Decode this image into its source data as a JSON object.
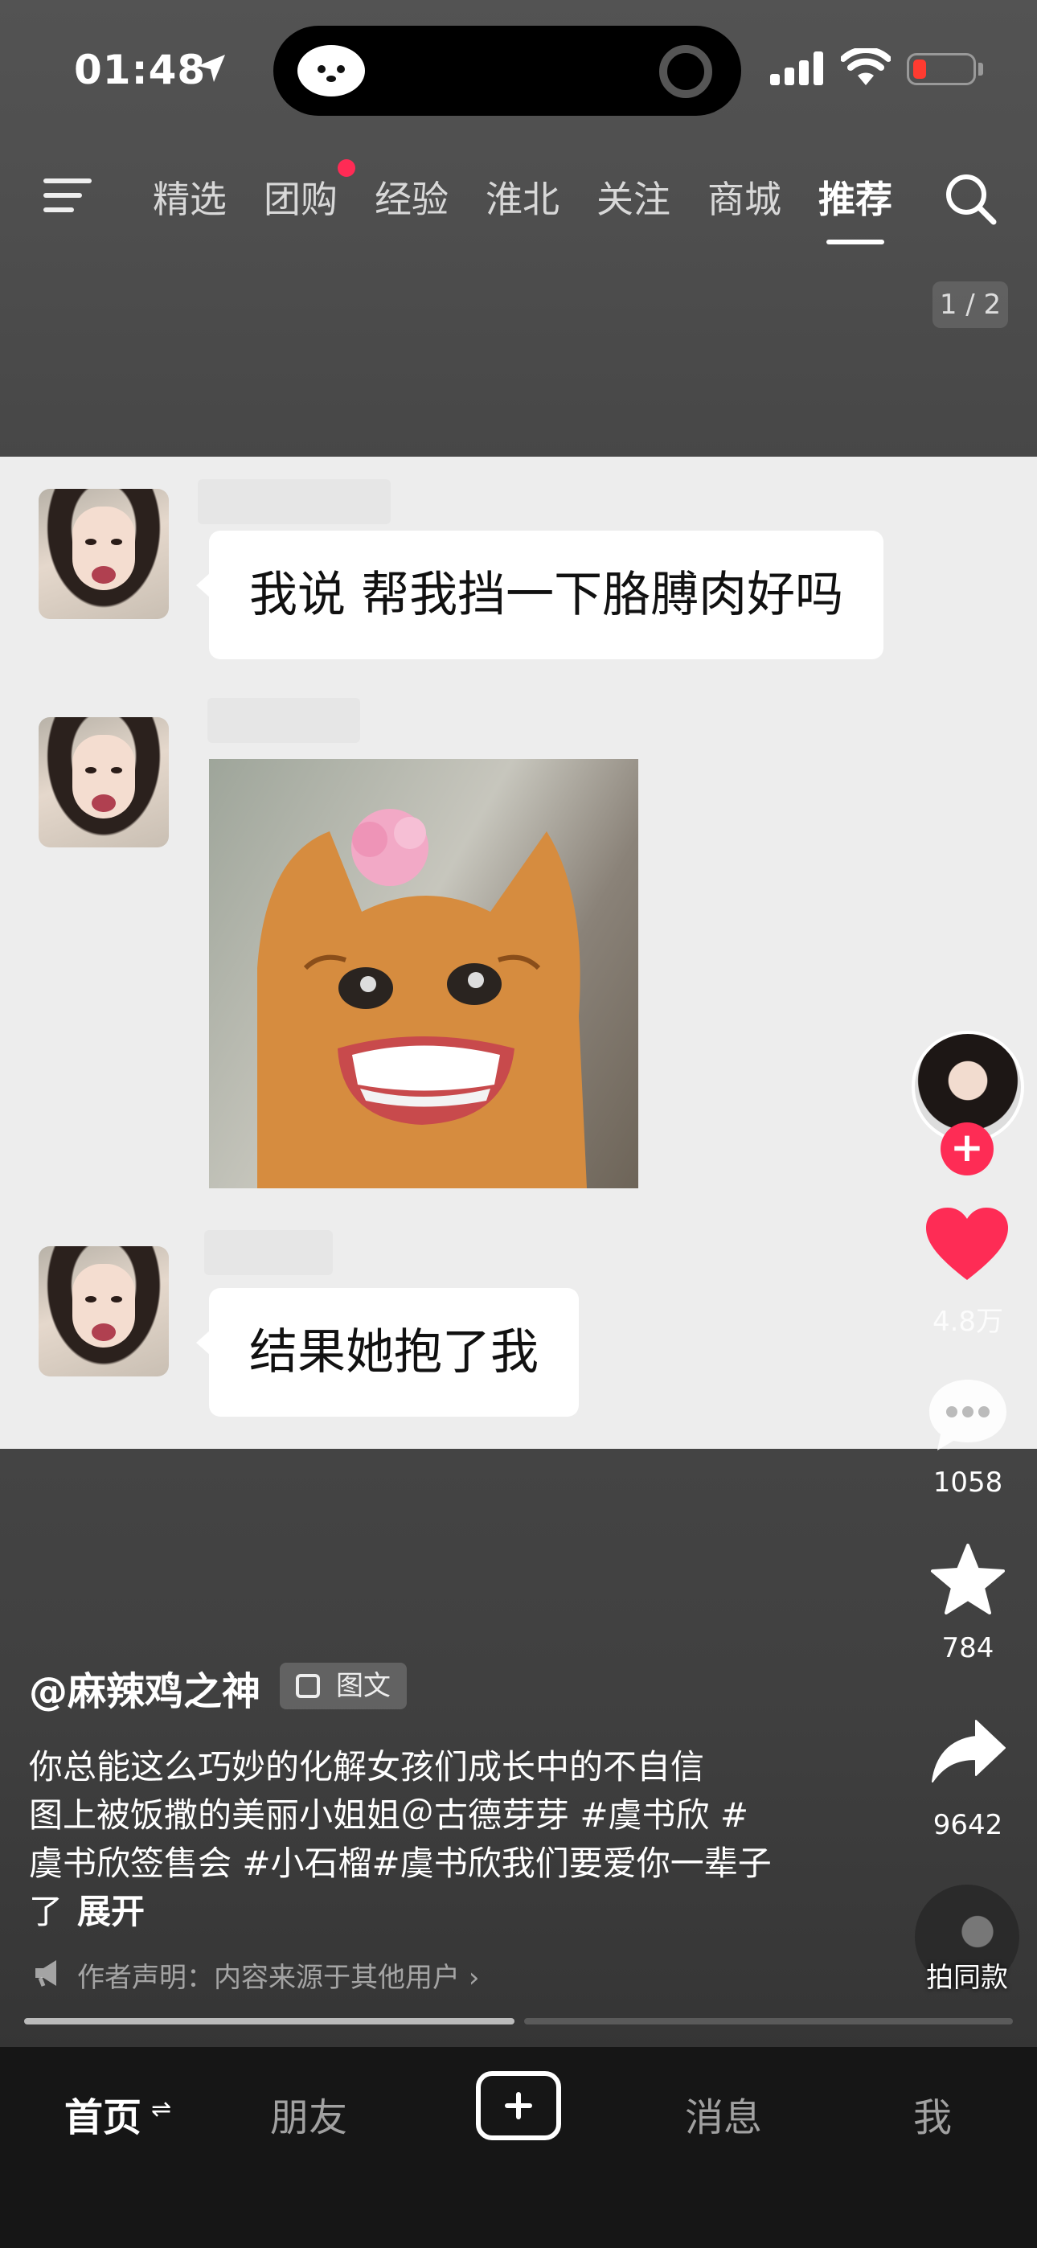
{
  "status_bar": {
    "time": "01:48",
    "battery_color": "#ff3b30"
  },
  "top_nav": {
    "tabs": [
      {
        "label": "精选"
      },
      {
        "label": "团购",
        "badge_dot": true
      },
      {
        "label": "经验"
      },
      {
        "label": "淮北"
      },
      {
        "label": "关注"
      },
      {
        "label": "商城"
      },
      {
        "label": "推荐",
        "active": true
      }
    ],
    "page_indicator": "1 / 2"
  },
  "post_image": {
    "messages": [
      {
        "type": "text",
        "text": "我说 帮我挡一下胳膊肉好吗"
      },
      {
        "type": "image",
        "icon": "smiling-cat-meme-image"
      },
      {
        "type": "text",
        "text": "结果她抱了我"
      }
    ]
  },
  "actions": {
    "likes": "4.8万",
    "comments": "1058",
    "favorites": "784",
    "shares": "9642",
    "like_color": "#fe2c55",
    "follow_color": "#fe2c55"
  },
  "post": {
    "author": "@麻辣鸡之神",
    "type_label": "图文",
    "caption_lines": [
      "你总能这么巧妙的化解女孩们成长中的不自信",
      "图上被饭撒的美丽小姐姐＠古德芽芽 #虞书欣 #",
      "虞书欣签售会 #小石榴#虞书欣我们要爱你一辈子",
      "了"
    ],
    "expand_label": "展开",
    "disclaimer": "作者声明：内容来源于其他用户",
    "music_label": "拍同款",
    "progress_page": 1,
    "progress_total": 2
  },
  "tab_bar": {
    "home": "首页",
    "friends": "朋友",
    "messages": "消息",
    "me": "我"
  }
}
